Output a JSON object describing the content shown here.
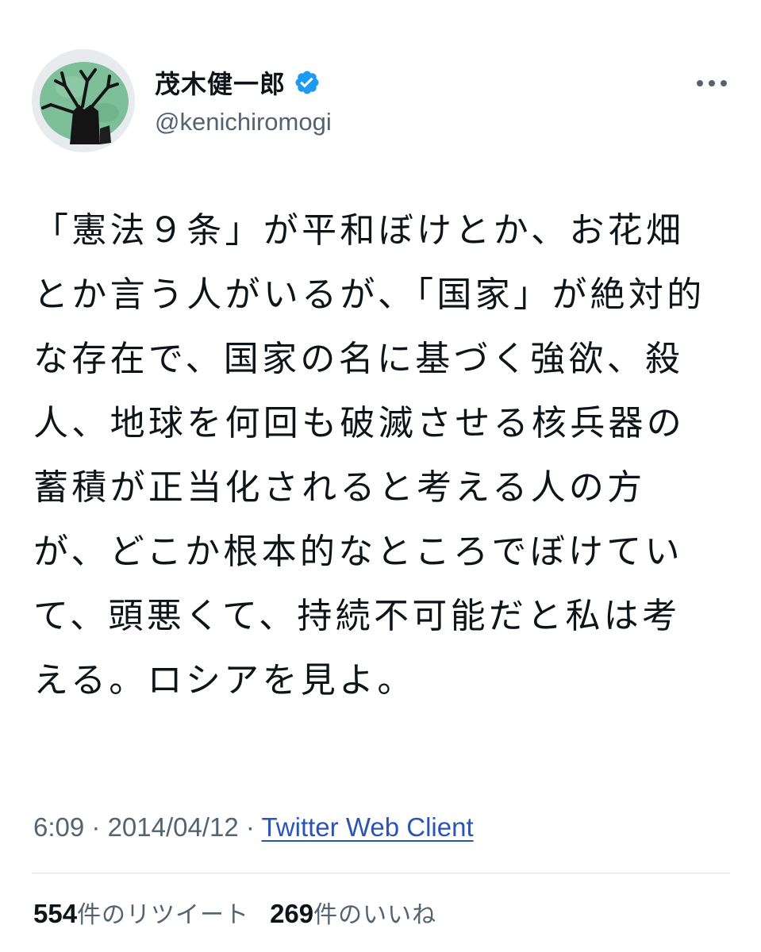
{
  "tweet": {
    "author": {
      "display_name": "茂木健一郎",
      "handle": "@kenichiromogi",
      "verified": true,
      "avatar_icon": "avatar-tree-drawing"
    },
    "more_icon": "more-horizontal-icon",
    "text": "「憲法９条」が平和ぼけとか、お花畑とか言う人がいるが、「国家」が絶対的な存在で、国家の名に基づく強欲、殺人、地球を何回も破滅させる核兵器の蓄積が正当化されると考える人の方が、どこか根本的なところでぼけていて、頭悪くて、持続不可能だと私は考える。ロシアを見よ。",
    "time": "6:09",
    "separator": " · ",
    "date": "2014/04/12",
    "source": "Twitter Web Client",
    "stats": {
      "retweets_count": "554",
      "retweets_label": "件のリツイート",
      "likes_count": "269",
      "likes_label": "件のいいね"
    },
    "colors": {
      "verified_badge": "#1d9bf0",
      "source_link": "#2a55b5",
      "secondary_text": "#536471",
      "avatar_background": "#7dbf98"
    }
  }
}
